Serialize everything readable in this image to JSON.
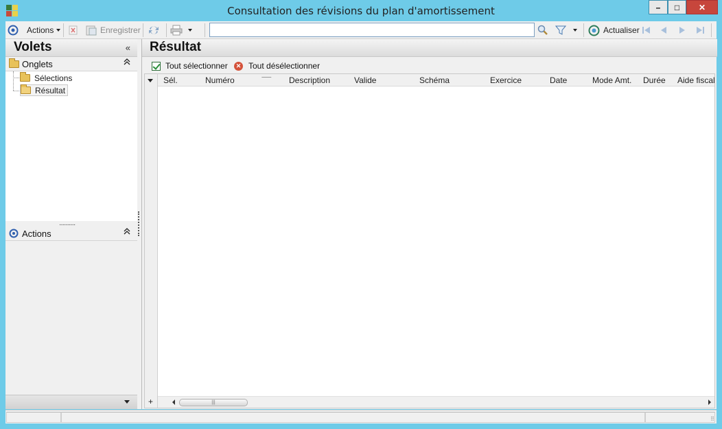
{
  "window": {
    "title": "Consultation des révisions du plan d'amortissement",
    "controls": {
      "minimize": "–",
      "maximize": "□",
      "close": "✕"
    }
  },
  "toolbar": {
    "actions_label": "Actions",
    "save_label": "Enregistrer",
    "search_value": "",
    "refresh_label": "Actualiser"
  },
  "left_pane": {
    "title": "Volets",
    "collapse": "«",
    "tabs_group": {
      "label": "Onglets",
      "chevron": "⌃"
    },
    "tree_items": [
      {
        "label": "Sélections",
        "selected": false
      },
      {
        "label": "Résultat",
        "selected": true
      }
    ],
    "actions_group": {
      "label": "Actions",
      "chevron": "⌃"
    }
  },
  "result_pane": {
    "title": "Résultat",
    "select_all": "Tout sélectionner",
    "deselect_all": "Tout désélectionner",
    "columns": [
      "Sél.",
      "Numéro",
      "Description",
      "Valide",
      "Schéma",
      "Exercice",
      "Date",
      "Mode Amt.",
      "Durée",
      "Aide fiscal"
    ],
    "add_row": "+",
    "scroll_thumb": "|||"
  },
  "colors": {
    "window_frame": "#6ecbe8",
    "close_button": "#c7463c",
    "panel_bg": "#f0f0f0",
    "folder": "#e8c25a"
  }
}
